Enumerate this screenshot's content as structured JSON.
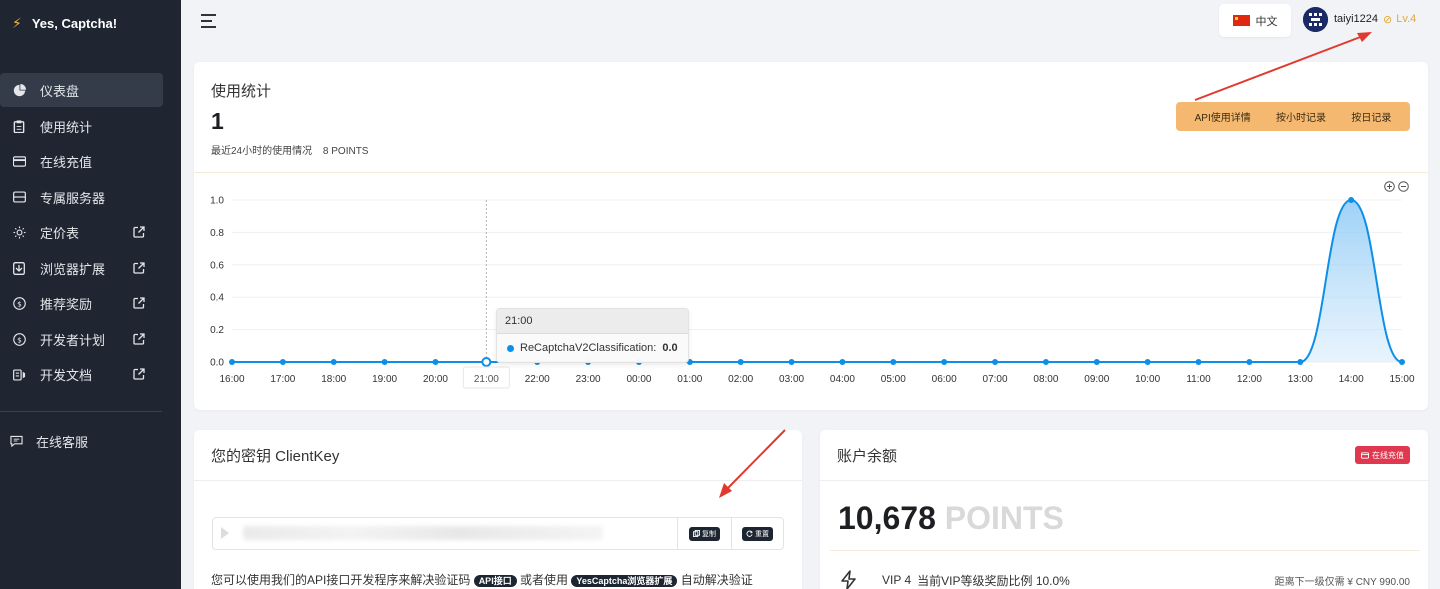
{
  "brand": {
    "name": "Yes, Captcha!"
  },
  "sidebar": {
    "items": [
      {
        "label": "仪表盘",
        "icon": "pie-chart-icon",
        "active": true,
        "external": false
      },
      {
        "label": "使用统计",
        "icon": "clipboard-icon",
        "active": false,
        "external": false
      },
      {
        "label": "在线充值",
        "icon": "credit-card-icon",
        "active": false,
        "external": false
      },
      {
        "label": "专属服务器",
        "icon": "server-icon",
        "active": false,
        "external": false
      },
      {
        "label": "定价表",
        "icon": "sun-icon",
        "active": false,
        "external": true
      },
      {
        "label": "浏览器扩展",
        "icon": "save-icon",
        "active": false,
        "external": true
      },
      {
        "label": "推荐奖励",
        "icon": "dollar-icon",
        "active": false,
        "external": true
      },
      {
        "label": "开发者计划",
        "icon": "dollar-icon",
        "active": false,
        "external": true
      },
      {
        "label": "开发文档",
        "icon": "book-icon",
        "active": false,
        "external": true
      }
    ],
    "support_label": "在线客服"
  },
  "topbar": {
    "language": "中文",
    "username": "taiyi1224",
    "level": "Lv.4"
  },
  "stats": {
    "title": "使用统计",
    "count": "1",
    "desc": "最近24小时的使用情况",
    "points": "8 POINTS",
    "buttons": [
      "API使用详情",
      "按小时记录",
      "按日记录"
    ]
  },
  "chart_data": {
    "type": "area",
    "x": [
      "16:00",
      "17:00",
      "18:00",
      "19:00",
      "20:00",
      "21:00",
      "22:00",
      "23:00",
      "00:00",
      "01:00",
      "02:00",
      "03:00",
      "04:00",
      "05:00",
      "06:00",
      "07:00",
      "08:00",
      "09:00",
      "10:00",
      "11:00",
      "12:00",
      "13:00",
      "14:00",
      "15:00"
    ],
    "series": [
      {
        "name": "ReCaptchaV2Classification",
        "values": [
          0,
          0,
          0,
          0,
          0,
          0,
          0,
          0,
          0,
          0,
          0,
          0,
          0,
          0,
          0,
          0,
          0,
          0,
          0,
          0,
          0,
          0,
          1.0,
          0
        ]
      }
    ],
    "yticks": [
      "0.0",
      "0.2",
      "0.4",
      "0.6",
      "0.8",
      "1.0"
    ],
    "ylim": [
      0,
      1
    ],
    "tooltip": {
      "x": "21:00",
      "series": "ReCaptchaV2Classification:",
      "value": "0.0"
    },
    "color": "#0d8fe8"
  },
  "clientkey": {
    "title": "您的密钥 ClientKey",
    "copy_label": "复制",
    "reset_label": "重置",
    "desc_before": "您可以使用我们的API接口开发程序来解决验证码",
    "tag_api": "API接口",
    "desc_mid": "或者使用",
    "tag_ext": "YesCaptcha浏览器扩展",
    "desc_after": "自动解决验证"
  },
  "balance": {
    "title": "账户余额",
    "recharge_label": "在线充值",
    "amount": "10,678",
    "unit": "POINTS",
    "vip_level": "VIP 4",
    "vip_desc": "当前VIP等级奖励比例 10.0%",
    "next_level": "距离下一级仅需 ¥ CNY 990.00"
  }
}
